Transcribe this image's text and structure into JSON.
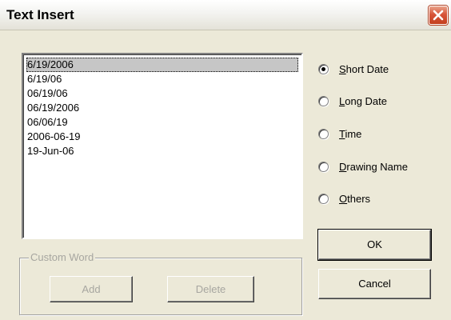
{
  "window": {
    "title": "Text Insert"
  },
  "date_list": {
    "items": [
      "6/19/2006",
      "6/19/06",
      "06/19/06",
      "06/19/2006",
      "06/06/19",
      "2006-06-19",
      "19-Jun-06"
    ],
    "selected_index": 0
  },
  "format_options": [
    {
      "accel": "S",
      "rest": "hort Date",
      "checked": true
    },
    {
      "accel": "L",
      "rest": "ong Date",
      "checked": false
    },
    {
      "accel": "T",
      "rest": "ime",
      "checked": false
    },
    {
      "accel": "D",
      "rest": "rawing Name",
      "checked": false
    },
    {
      "accel": "O",
      "rest": "thers",
      "checked": false
    }
  ],
  "custom_word": {
    "group_label": "Custom Word",
    "add_label": "Add",
    "delete_label": "Delete"
  },
  "buttons": {
    "ok_label": "OK",
    "cancel_label": "Cancel"
  }
}
